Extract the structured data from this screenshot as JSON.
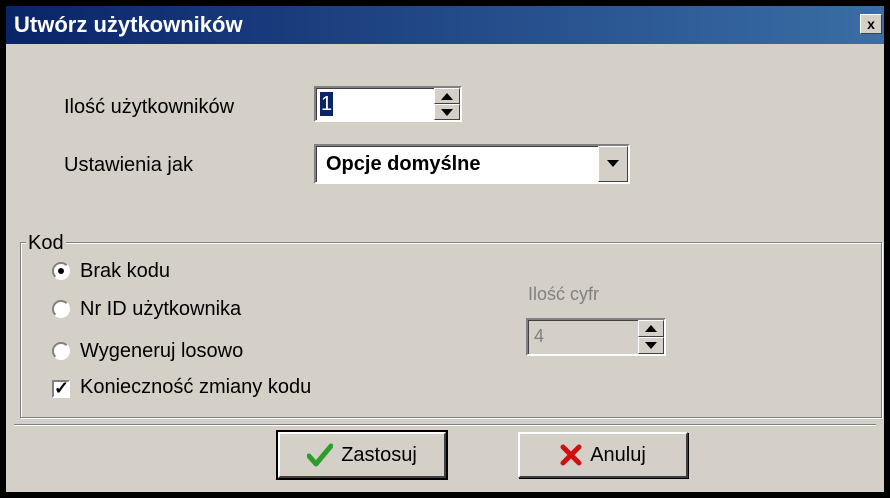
{
  "window": {
    "title": "Utwórz użytkowników",
    "close_label": "x"
  },
  "fields": {
    "user_count_label": "Ilość użytkowników",
    "user_count_value": "1",
    "settings_label": "Ustawienia jak",
    "settings_value": "Opcje domyślne"
  },
  "code_group": {
    "title": "Kod",
    "options": [
      {
        "label": "Brak kodu",
        "selected": true
      },
      {
        "label": "Nr ID użytkownika",
        "selected": false
      },
      {
        "label": "Wygeneruj losowo",
        "selected": false
      }
    ],
    "digits_label": "Ilość cyfr",
    "digits_value": "4",
    "force_change_label": "Konieczność zmiany kodu",
    "force_change_checked": true
  },
  "buttons": {
    "apply_label": "Zastosuj",
    "cancel_label": "Anuluj"
  },
  "colors": {
    "title_bar": "#0a246a",
    "face": "#d4d0c8",
    "apply_icon": "#2a9d2a",
    "cancel_icon": "#d01010"
  },
  "icons": {
    "apply": "checkmark-icon",
    "cancel": "x-mark-icon"
  }
}
